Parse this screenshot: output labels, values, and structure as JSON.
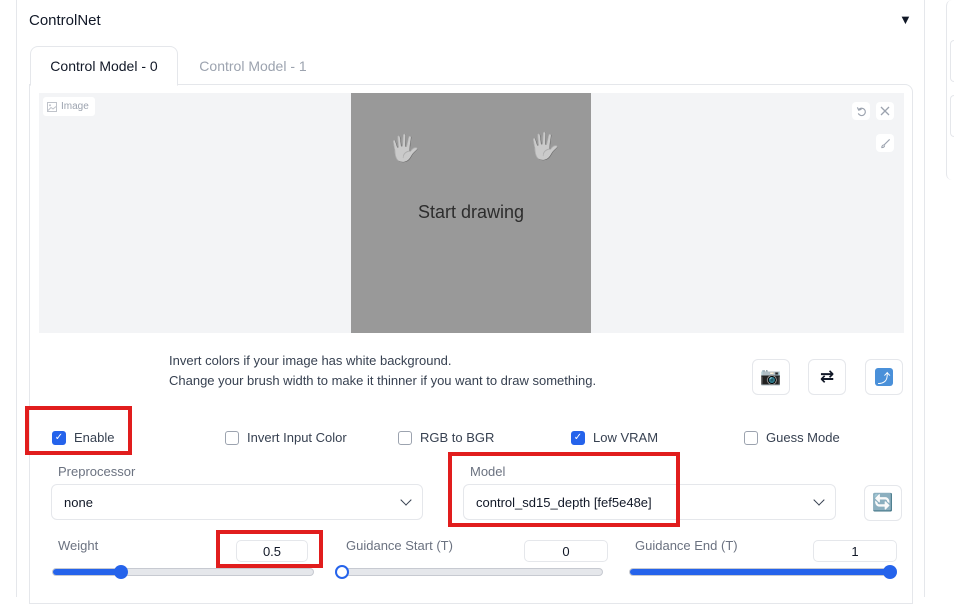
{
  "accordion": {
    "title": "ControlNet",
    "toggle_icon": "▼"
  },
  "tabs": [
    {
      "label": "Control Model - 0",
      "active": true
    },
    {
      "label": "Control Model - 1",
      "active": false
    }
  ],
  "image": {
    "label": "Image",
    "canvas_text": "Start drawing",
    "canvas_color": "#999999",
    "undo_icon": "undo-icon",
    "clear_icon": "close-icon",
    "brush_icon": "brush-icon"
  },
  "hint": {
    "line1": "Invert colors if your image has white background.",
    "line2": "Change your brush width to make it thinner if you want to draw something."
  },
  "tool_buttons": {
    "camera": "📷",
    "swap": "⇄",
    "upload": "⤴"
  },
  "checkboxes": {
    "enable": {
      "label": "Enable",
      "checked": true
    },
    "invert": {
      "label": "Invert Input Color",
      "checked": false
    },
    "rgb": {
      "label": "RGB to BGR",
      "checked": false
    },
    "lowvram": {
      "label": "Low VRAM",
      "checked": true
    },
    "guess": {
      "label": "Guess Mode",
      "checked": false
    }
  },
  "preprocessor": {
    "label": "Preprocessor",
    "value": "none"
  },
  "model": {
    "label": "Model",
    "value": "control_sd15_depth [fef5e48e]",
    "refresh_icon": "🔄"
  },
  "sliders": {
    "weight": {
      "label": "Weight",
      "value": "0.5",
      "fraction": 0.26
    },
    "guidance_start": {
      "label": "Guidance Start (T)",
      "value": "0",
      "fraction": 0
    },
    "guidance_end": {
      "label": "Guidance End (T)",
      "value": "1",
      "fraction": 1
    }
  },
  "colors": {
    "accent": "#2563eb",
    "highlight": "#e11d1d"
  }
}
